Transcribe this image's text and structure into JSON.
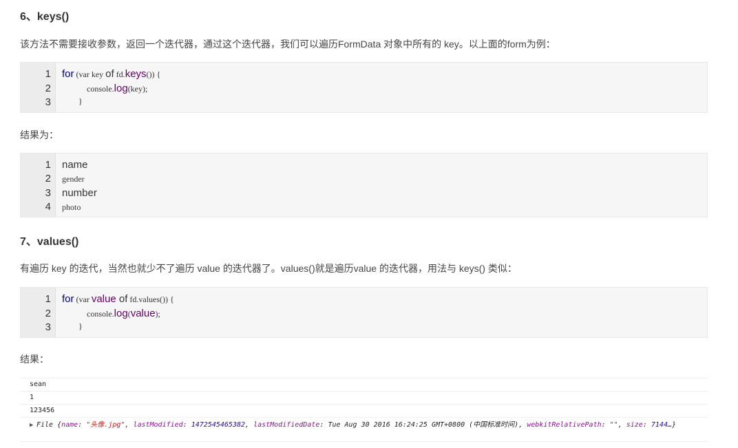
{
  "section6": {
    "heading": "6、keys()",
    "desc": "该方法不需要接收参数，返回一个迭代器，通过这个迭代器，我们可以遍历FormData 对象中所有的 key。以上面的form为例：",
    "code": {
      "line_numbers": [
        "1",
        "2",
        "3"
      ],
      "l1_for": "for",
      "l1_mid": " (var key ",
      "l1_of": "of",
      "l1_fd": " fd.",
      "l1_keys": "keys",
      "l1_end": "()) {",
      "l2_console": "            console.",
      "l2_log": "log",
      "l2_end": "(key);",
      "l3": "        }"
    },
    "result_label": "结果为：",
    "result": {
      "line_numbers": [
        "1",
        "2",
        "3",
        "4"
      ],
      "lines": [
        "name",
        "gender",
        "number",
        "photo"
      ]
    }
  },
  "section7": {
    "heading": "7、values()",
    "desc": "有遍历 key 的迭代，当然也就少不了遍历 value 的迭代器了。values()就是遍历value 的迭代器，用法与 keys() 类似：",
    "code": {
      "line_numbers": [
        "1",
        "2",
        "3"
      ],
      "l1_for": "for",
      "l1_mid": " (var ",
      "l1_value": "value",
      "l1_of": " of",
      "l1_end": " fd.values()) {",
      "l2_console": "            console.",
      "l2_log": "log",
      "l2_open": "(",
      "l2_value": "value",
      "l2_end": ");",
      "l3": "        }"
    },
    "result_label": "结果：",
    "console": {
      "rows": [
        "sean",
        "1",
        "123456"
      ],
      "file_obj": {
        "prefix": "File {",
        "k_name": "name",
        "v_name": "\"头像.jpg\"",
        "k_lm": "lastModified",
        "v_lm": "1472545465382",
        "k_lmd": "lastModifiedDate",
        "v_lmd": "Tue Aug 30 2016 16:24:25 GMT+0800 (中国标准时间)",
        "k_wrp": "webkitRelativePath",
        "v_wrp": "\"\"",
        "k_size": "size",
        "v_size": "7144",
        "suffix": "…}"
      }
    }
  },
  "colors": {
    "keyword": "#000088",
    "function": "#660066",
    "console_key": "#881391",
    "console_string": "#c41a16",
    "console_number": "#1c00cf"
  }
}
